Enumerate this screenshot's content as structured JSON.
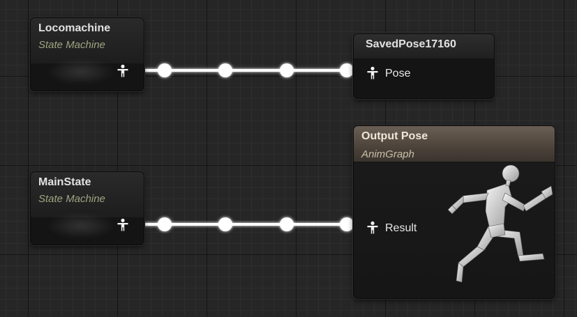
{
  "graph": {
    "nodes": {
      "locomachine": {
        "title": "Locomachine",
        "subtitle": "State Machine"
      },
      "saved_pose": {
        "title": "SavedPose17160",
        "pin_label": "Pose"
      },
      "main_state": {
        "title": "MainState",
        "subtitle": "State Machine"
      },
      "output_pose": {
        "title": "Output Pose",
        "subtitle": "AnimGraph",
        "pin_label": "Result"
      }
    },
    "icons": {
      "pose_pin": "person-pose-icon",
      "preview": "running-mannequin-icon"
    },
    "colors": {
      "wire": "#ffffff",
      "output_header": "#6b5f53",
      "subtitle": "#a0a482"
    }
  }
}
